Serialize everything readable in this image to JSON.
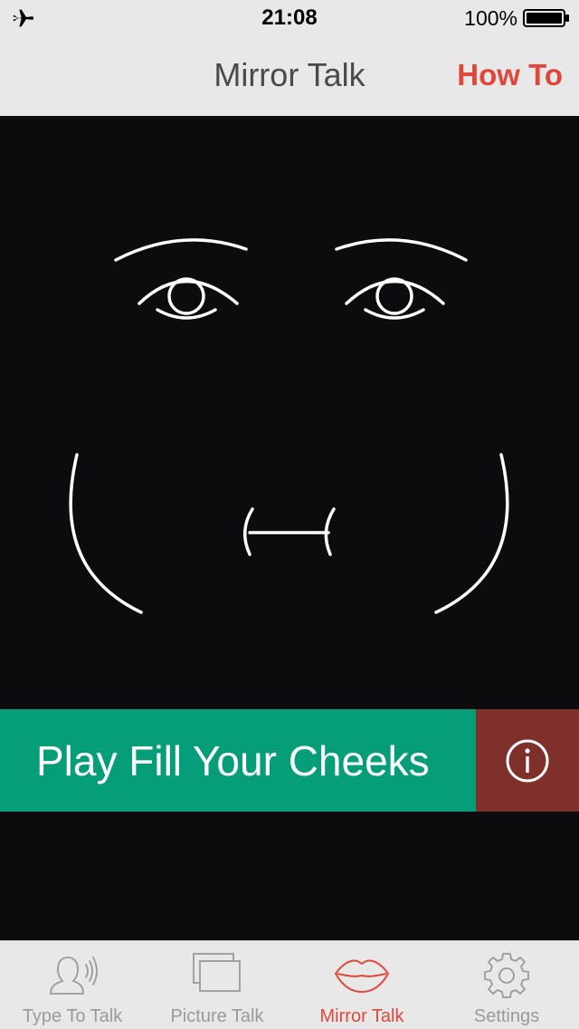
{
  "status_bar": {
    "time": "21:08",
    "battery_percent": "100%",
    "icons": [
      "airplane-mode-icon",
      "battery-icon"
    ]
  },
  "nav_bar": {
    "title": "Mirror Talk",
    "how_to_label": "How To"
  },
  "exercise": {
    "play_label": "Play Fill Your Cheeks",
    "info_icon": "info-icon"
  },
  "tabs": [
    {
      "label": "Type To Talk",
      "icon": "type-to-talk-icon",
      "active": false
    },
    {
      "label": "Picture Talk",
      "icon": "picture-talk-icon",
      "active": false
    },
    {
      "label": "Mirror Talk",
      "icon": "lips-icon",
      "active": true
    },
    {
      "label": "Settings",
      "icon": "gear-icon",
      "active": false
    }
  ],
  "colors": {
    "accent": "#e0473b",
    "play_button": "#069e78",
    "info_button": "#80302a",
    "background": "#0c0b0d",
    "bar_background": "#e8e8e8"
  }
}
